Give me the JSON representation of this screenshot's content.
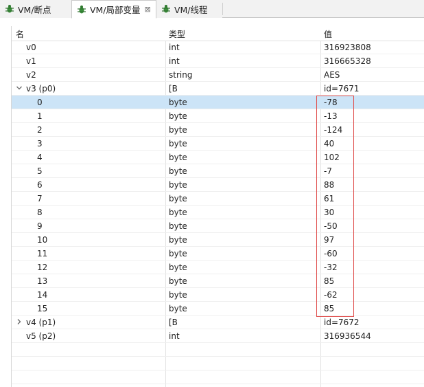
{
  "tabs": [
    {
      "label": "VM/断点",
      "icon": "bug-icon"
    },
    {
      "label": "VM/局部变量",
      "icon": "bug-icon",
      "close": "⊠"
    },
    {
      "label": "VM/线程",
      "icon": "bug-icon"
    }
  ],
  "columns": {
    "name": "名",
    "type": "类型",
    "value": "值"
  },
  "rows": [
    {
      "name": "v0",
      "type": "int",
      "value": "316923808"
    },
    {
      "name": "v1",
      "type": "int",
      "value": "316665328"
    },
    {
      "name": "v2",
      "type": "string",
      "value": "AES"
    },
    {
      "name": "v3 (p0)",
      "type": "[B",
      "value": "id=7671",
      "expanded": true
    },
    {
      "name": "0",
      "type": "byte",
      "value": "-78",
      "selected": true
    },
    {
      "name": "1",
      "type": "byte",
      "value": "-13"
    },
    {
      "name": "2",
      "type": "byte",
      "value": "-124"
    },
    {
      "name": "3",
      "type": "byte",
      "value": "40"
    },
    {
      "name": "4",
      "type": "byte",
      "value": "102"
    },
    {
      "name": "5",
      "type": "byte",
      "value": "-7"
    },
    {
      "name": "6",
      "type": "byte",
      "value": "88"
    },
    {
      "name": "7",
      "type": "byte",
      "value": "61"
    },
    {
      "name": "8",
      "type": "byte",
      "value": "30"
    },
    {
      "name": "9",
      "type": "byte",
      "value": "-50"
    },
    {
      "name": "10",
      "type": "byte",
      "value": "97"
    },
    {
      "name": "11",
      "type": "byte",
      "value": "-60"
    },
    {
      "name": "12",
      "type": "byte",
      "value": "-32"
    },
    {
      "name": "13",
      "type": "byte",
      "value": "85"
    },
    {
      "name": "14",
      "type": "byte",
      "value": "-62"
    },
    {
      "name": "15",
      "type": "byte",
      "value": "85"
    },
    {
      "name": "v4 (p1)",
      "type": "[B",
      "value": "id=7672",
      "expanded": false
    },
    {
      "name": "v5 (p2)",
      "type": "int",
      "value": "316936544"
    },
    {
      "name": "",
      "type": "",
      "value": ""
    },
    {
      "name": "",
      "type": "",
      "value": ""
    },
    {
      "name": "",
      "type": "",
      "value": ""
    }
  ],
  "colors": {
    "selection": "#cce4f7",
    "highlight_box": "#e0504f"
  }
}
